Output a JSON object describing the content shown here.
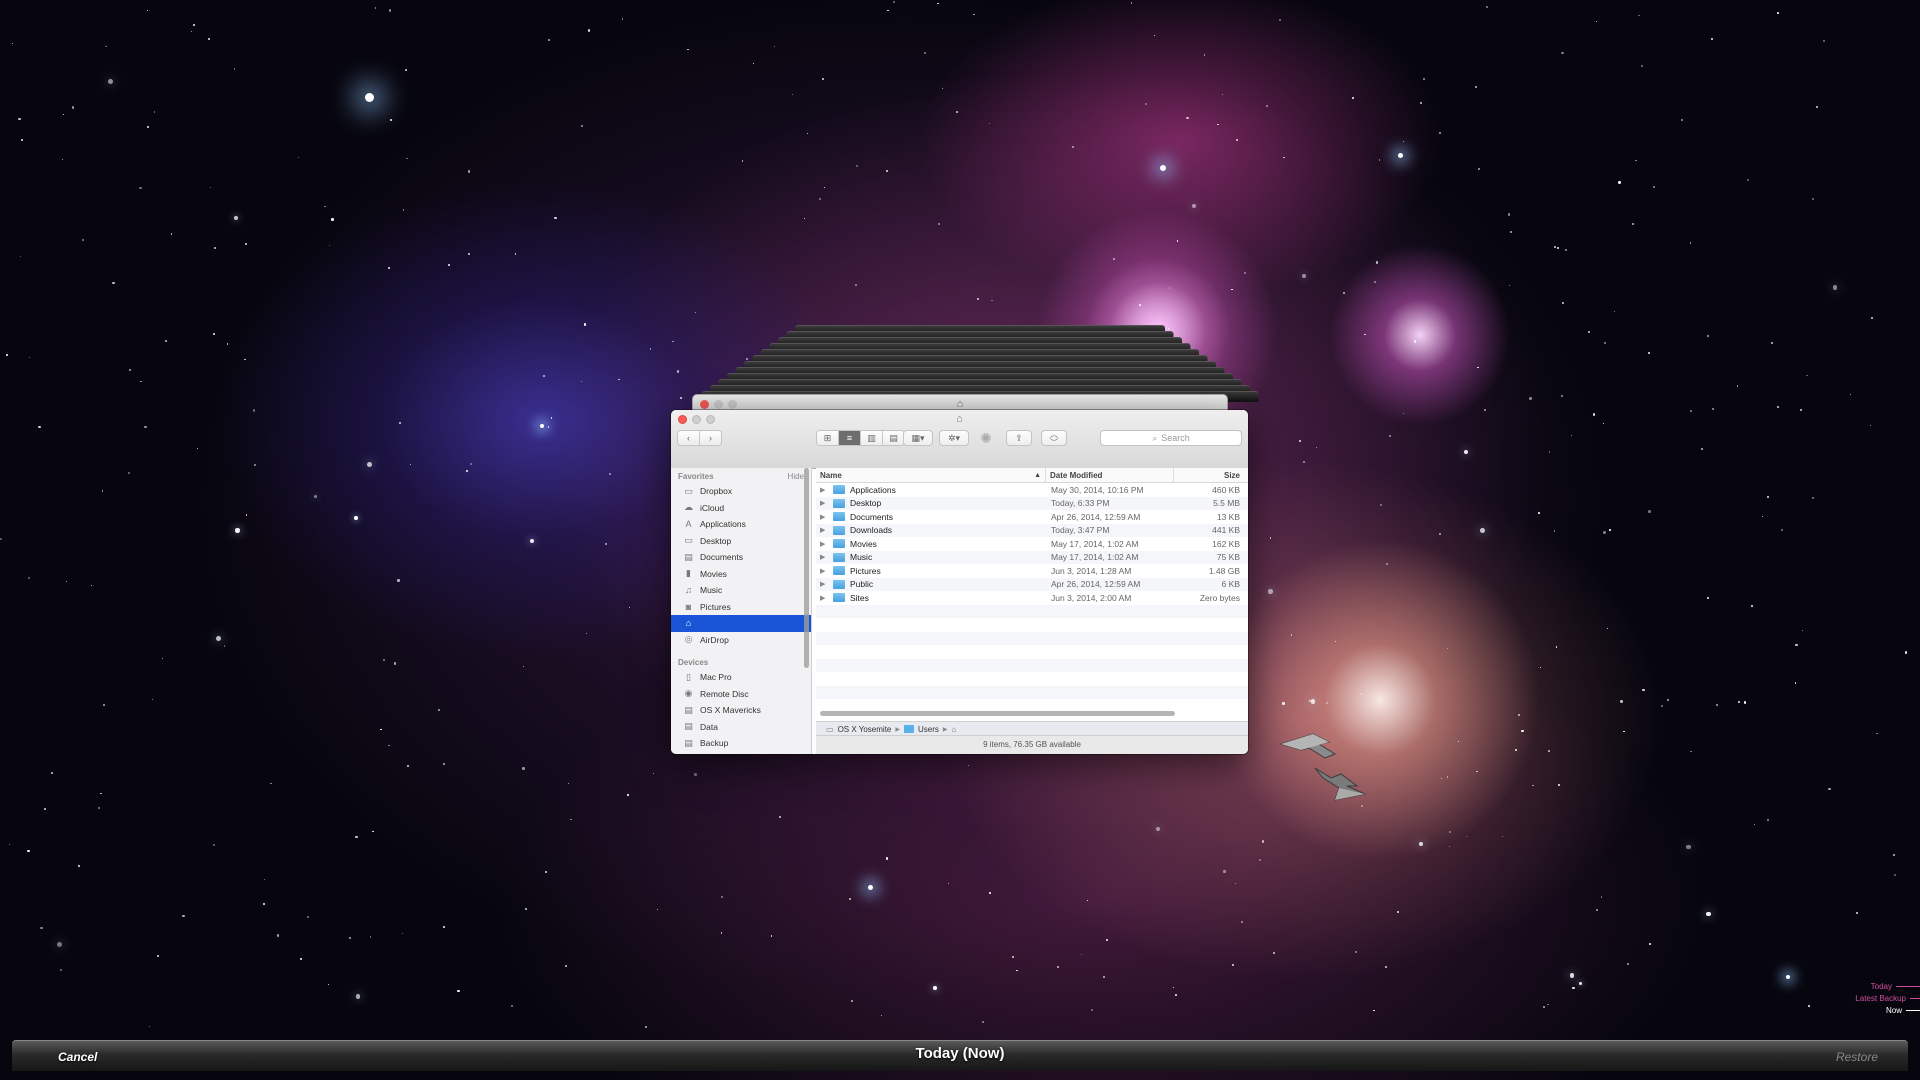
{
  "window": {
    "title_icon": "home-icon",
    "controls": [
      "close",
      "minimize",
      "zoom"
    ]
  },
  "toolbar": {
    "back_icon": "chevron-left-icon",
    "forward_icon": "chevron-right-icon",
    "view_modes": [
      "icon-view",
      "list-view",
      "column-view",
      "coverflow-view"
    ],
    "active_view": "list-view",
    "search_placeholder": "Search"
  },
  "sidebar": {
    "favorites_header": "Favorites",
    "hide_label": "Hide",
    "favorites": [
      {
        "label": "Dropbox",
        "icon": "folder-icon"
      },
      {
        "label": "iCloud",
        "icon": "cloud-icon"
      },
      {
        "label": "Applications",
        "icon": "applications-icon"
      },
      {
        "label": "Desktop",
        "icon": "desktop-icon"
      },
      {
        "label": "Documents",
        "icon": "documents-icon"
      },
      {
        "label": "Movies",
        "icon": "movies-icon"
      },
      {
        "label": "Music",
        "icon": "music-icon"
      },
      {
        "label": "Pictures",
        "icon": "camera-icon"
      },
      {
        "label": "",
        "icon": "home-icon",
        "selected": true
      },
      {
        "label": "AirDrop",
        "icon": "airdrop-icon"
      }
    ],
    "devices_header": "Devices",
    "devices": [
      {
        "label": "Mac Pro",
        "icon": "computer-icon"
      },
      {
        "label": "Remote Disc",
        "icon": "disc-icon"
      },
      {
        "label": "OS X Mavericks",
        "icon": "drive-icon"
      },
      {
        "label": "Data",
        "icon": "drive-icon"
      },
      {
        "label": "Backup",
        "icon": "drive-icon"
      }
    ]
  },
  "columns": {
    "name": "Name",
    "date": "Date Modified",
    "size": "Size"
  },
  "files": [
    {
      "name": "Applications",
      "date": "May 30, 2014, 10:16 PM",
      "size": "460 KB"
    },
    {
      "name": "Desktop",
      "date": "Today, 6:33 PM",
      "size": "5.5 MB"
    },
    {
      "name": "Documents",
      "date": "Apr 26, 2014, 12:59 AM",
      "size": "13 KB"
    },
    {
      "name": "Downloads",
      "date": "Today, 3:47 PM",
      "size": "441 KB"
    },
    {
      "name": "Movies",
      "date": "May 17, 2014, 1:02 AM",
      "size": "162 KB"
    },
    {
      "name": "Music",
      "date": "May 17, 2014, 1:02 AM",
      "size": "75 KB"
    },
    {
      "name": "Pictures",
      "date": "Jun 3, 2014, 1:28 AM",
      "size": "1.48 GB"
    },
    {
      "name": "Public",
      "date": "Apr 26, 2014, 12:59 AM",
      "size": "6 KB"
    },
    {
      "name": "Sites",
      "date": "Jun 3, 2014, 2:00 AM",
      "size": "Zero bytes"
    }
  ],
  "pathbar": [
    "OS X Yosemite",
    "Users"
  ],
  "status": "9 items, 76.35 GB available",
  "timemachine": {
    "cancel_label": "Cancel",
    "current_label": "Today (Now)",
    "restore_label": "Restore",
    "timeline": [
      "Today",
      "Latest Backup",
      "Now"
    ]
  },
  "colors": {
    "selection": "#1a55d8",
    "folder": "#5ab0ea",
    "timeline_accent": "#d04ea0"
  }
}
